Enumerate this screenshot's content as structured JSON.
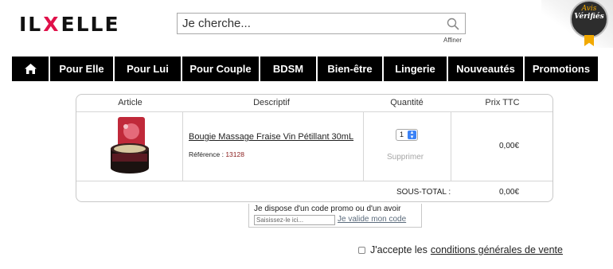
{
  "header": {
    "logo": {
      "part1": "IL",
      "part2": "X",
      "part3": "ELLE"
    },
    "search": {
      "placeholder": "Je cherche...",
      "refine_label": "Affiner"
    },
    "badge": {
      "line1": "Avis",
      "line2": "Vérifiés"
    }
  },
  "nav": {
    "items": [
      "Pour Elle",
      "Pour Lui",
      "Pour Couple",
      "BDSM",
      "Bien-être",
      "Lingerie",
      "Nouveautés",
      "Promotions"
    ]
  },
  "cart": {
    "columns": [
      "Article",
      "Descriptif",
      "Quantité",
      "Prix TTC"
    ],
    "item": {
      "name": "Bougie Massage Fraise Vin Pétillant 30mL",
      "reference_label": "Référence : ",
      "reference": "13128",
      "quantity": "1",
      "remove_label": "Supprimer",
      "price": "0,00€"
    },
    "subtotal_label": "SOUS-TOTAL :",
    "subtotal_value": "0,00€"
  },
  "promo": {
    "title": "Je dispose d'un code promo ou d'un avoir",
    "placeholder": "Saisissez-le ici...",
    "validate_label": "Je valide mon code"
  },
  "terms": {
    "prefix": "J'accepte les",
    "link": "conditions générales de vente"
  },
  "colors": {
    "accent": "#e0114a",
    "nav_bg": "#000000",
    "badge_gold": "#f2a900"
  }
}
